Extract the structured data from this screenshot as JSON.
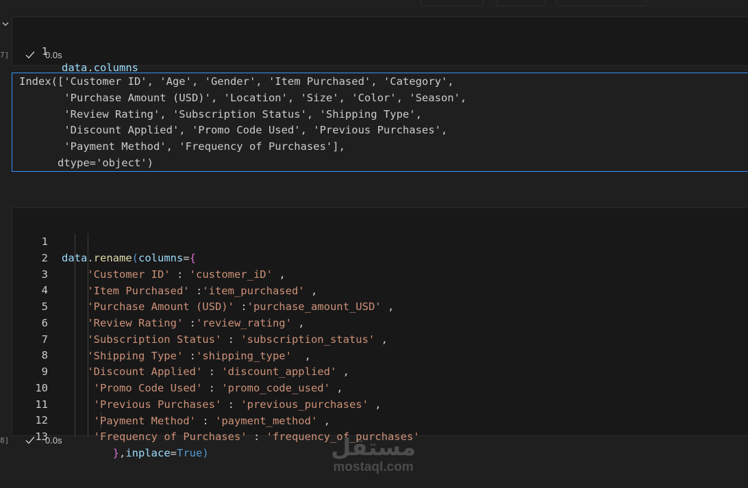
{
  "cell1": {
    "exec_count": "7]",
    "line_numbers": [
      "1"
    ],
    "status_time": "0.0s"
  },
  "output": {
    "lines": [
      "Index(['Customer ID', 'Age', 'Gender', 'Item Purchased', 'Category',",
      "       'Purchase Amount (USD)', 'Location', 'Size', 'Color', 'Season',",
      "       'Review Rating', 'Subscription Status', 'Shipping Type',",
      "       'Discount Applied', 'Promo Code Used', 'Previous Purchases',",
      "       'Payment Method', 'Frequency of Purchases'],",
      "      dtype='object')"
    ]
  },
  "cell2": {
    "exec_count": "8]",
    "line_numbers": [
      "1",
      "2",
      "3",
      "4",
      "5",
      "6",
      "7",
      "8",
      "9",
      "10",
      "11",
      "12",
      "13"
    ],
    "status_time": "0.0s"
  },
  "watermark": {
    "arabic": "مستقل",
    "latin": "mostaql.com"
  }
}
